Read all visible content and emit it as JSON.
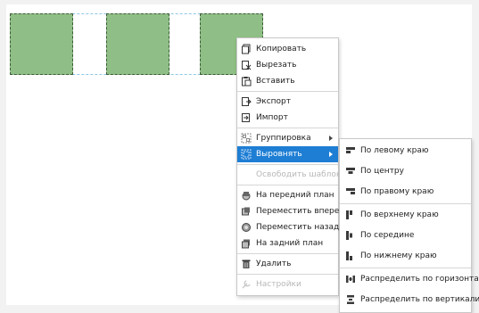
{
  "colors": {
    "shape_fill": "#8fbf86",
    "shape_border": "#3d5a3a",
    "selection": "#8ec7e6",
    "menu_highlight": "#1e7ed4"
  },
  "canvas": {
    "shapes": [
      "shape-1",
      "shape-2",
      "shape-3"
    ]
  },
  "context_menu": {
    "copy": "Копировать",
    "cut": "Вырезать",
    "paste": "Вставить",
    "export": "Экспорт",
    "import": "Импорт",
    "group": "Группировка",
    "align": "Выровнять",
    "release_template": "Освободить шаблон",
    "bring_front": "На передний план",
    "move_forward": "Переместить вперед",
    "move_backward": "Переместить назад",
    "send_back": "На задний план",
    "delete": "Удалить",
    "settings": "Настройки"
  },
  "align_submenu": {
    "left": "По левому краю",
    "center": "По центру",
    "right": "По правому краю",
    "top": "По верхнему краю",
    "middle": "По середине",
    "bottom": "По нижнему краю",
    "distribute_h": "Распределить по горизонтали",
    "distribute_v": "Распределить по вертикали"
  }
}
